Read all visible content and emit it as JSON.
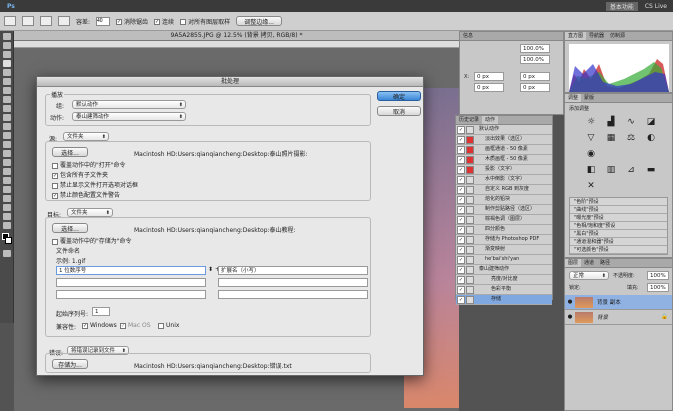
{
  "menubar": {
    "logo": "Ps",
    "workspace": "基本功能",
    "cslive": "CS Live"
  },
  "options": {
    "zoom_label": "容差:",
    "zoom_value": "40",
    "antialias": "消除锯齿",
    "contiguous": "连续",
    "sample_all": "对所有图层取样",
    "refine": "调整边缘..."
  },
  "document": {
    "title": "9A5A2855.JPG @ 12.5% (背景 拷贝, RGB/8) *"
  },
  "dialog": {
    "title": "批处理",
    "ok": "确定",
    "cancel": "取消",
    "play_group": "播放",
    "set_label": "组:",
    "set_value": "默认动作",
    "action_label": "动作:",
    "action_value": "泰山建筛动作",
    "source_label": "源:",
    "source_value": "文件夹",
    "choose_label": "选择...",
    "source_path": "Macintosh HD:Users:qianqiancheng:Desktop:泰山照片摄影:",
    "opt_override_open": "覆盖动作中的\"打开\"命令",
    "opt_include_sub": "包含所有子文件夹",
    "opt_suppress_open": "禁止显示文件打开选项对话框",
    "opt_suppress_color": "禁止颜色配置文件警告",
    "dest_label": "目标:",
    "dest_value": "文件夹",
    "dest_choose": "选择...",
    "dest_path": "Macintosh HD:Users:qianqiancheng:Desktop:泰山教程:",
    "opt_override_save": "覆盖动作中的\"存储为\"命令",
    "naming_label": "文件命名",
    "example": "示例: 1.gif",
    "name1": "1 位数序号",
    "name2": "扩展名（小写）",
    "serial_label": "起始序列号:",
    "serial_value": "1",
    "compat_label": "兼容性:",
    "compat_win": "Windows",
    "compat_mac": "Mac OS",
    "compat_unix": "Unix",
    "errors_label": "错误:",
    "errors_value": "将错误记录到文件",
    "saveas": "存储为...",
    "error_path": "Macintosh HD:Users:qianqiancheng:Desktop:错误.txt"
  },
  "info_panel": {
    "tab": "信息",
    "zoom1": "100.0%",
    "zoom2": "100.0%",
    "x": "0 px",
    "y": "0 px",
    "dx": "0 px",
    "dy": "0 px"
  },
  "actions_panel": {
    "tab1": "历史记录",
    "tab2": "动作",
    "items": [
      "默认动作",
      "淡出效果（选区）",
      "画框通道 - 50 像素",
      "木质画框 - 50 像素",
      "投影（文字）",
      "水中倒影（文字）",
      "自定义 RGB 到灰度",
      "熔化的铅块",
      "制作剪贴路径（选区）",
      "棕褐色调（图层）",
      "四分颜色",
      "存储为 Photoshop PDF",
      "渐变映射",
      "he'bai'shi'yan",
      "泰山建筛动作",
      "亮度/对比度",
      "色彩平衡",
      "存储"
    ]
  },
  "histogram": {
    "tab1": "直方图",
    "tab2": "导航器",
    "tab3": "仿制源"
  },
  "adjust_panel": {
    "tab1": "调整",
    "tab2": "蒙版",
    "title": "添加调整",
    "presets": [
      "\"色阶\"预设",
      "\"曲线\"预设",
      "\"曝光度\"预设",
      "\"色相/饱和度\"预设",
      "\"黑白\"预设",
      "\"通道混和器\"预设",
      "\"可选颜色\"预设"
    ]
  },
  "layers_panel": {
    "tab1": "图层",
    "tab2": "通道",
    "tab3": "路径",
    "blend": "正常",
    "opacity_label": "不透明度:",
    "opacity": "100%",
    "lock_label": "锁定:",
    "fill_label": "填充:",
    "fill": "100%",
    "layers": [
      "背景 副本",
      "背景"
    ]
  }
}
